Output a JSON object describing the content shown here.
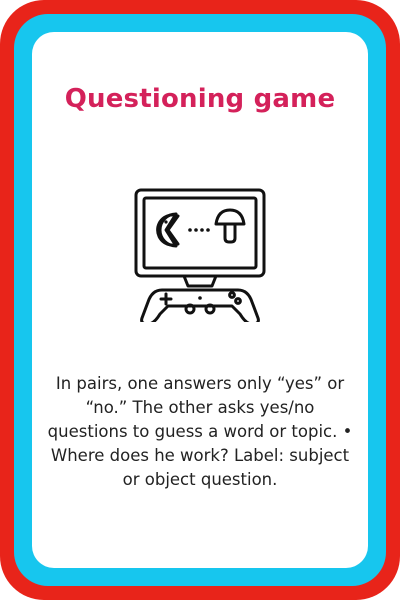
{
  "card": {
    "title": "Questioning game",
    "icon": "game-console-icon",
    "description": "In pairs, one answers only “yes” or “no.” The other asks yes/no questions to guess a word or topic. • Where does he work? Label: subject or object question."
  },
  "colors": {
    "outer_border": "#e8241a",
    "inner_border": "#17c6ee",
    "title": "#d4215a",
    "text": "#222222"
  }
}
